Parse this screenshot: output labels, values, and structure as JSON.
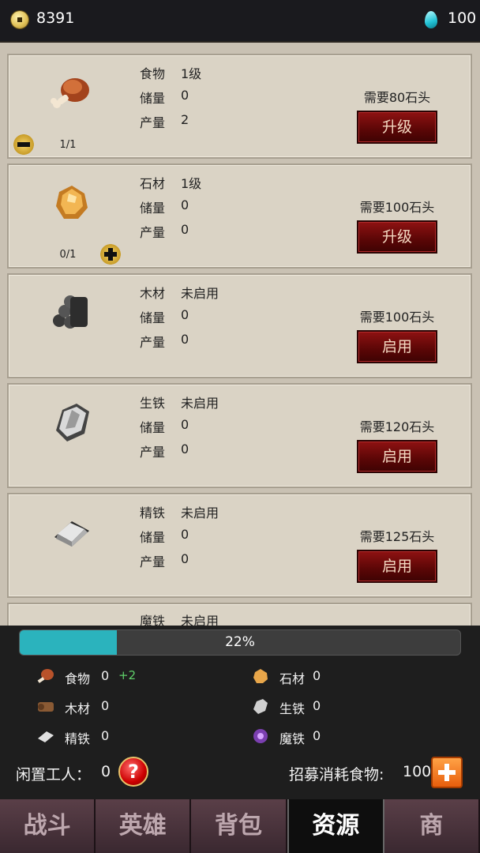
{
  "topbar": {
    "coins": "8391",
    "gems": "100"
  },
  "cards": [
    {
      "name": "食物",
      "level": "1级",
      "stock_label": "储量",
      "stock": "0",
      "prod_label": "产量",
      "prod": "2",
      "need": "需要80石头",
      "button": "升级",
      "workers": "1/1",
      "icon": "meat-icon"
    },
    {
      "name": "石材",
      "level": "1级",
      "stock_label": "储量",
      "stock": "0",
      "prod_label": "产量",
      "prod": "0",
      "need": "需要100石头",
      "button": "升级",
      "workers": "0/1",
      "icon": "stone-icon"
    },
    {
      "name": "木材",
      "level": "未启用",
      "stock_label": "储量",
      "stock": "0",
      "prod_label": "产量",
      "prod": "0",
      "need": "需要100石头",
      "button": "启用",
      "icon": "wood-icon"
    },
    {
      "name": "生铁",
      "level": "未启用",
      "stock_label": "储量",
      "stock": "0",
      "prod_label": "产量",
      "prod": "0",
      "need": "需要120石头",
      "button": "启用",
      "icon": "iron-ore-icon"
    },
    {
      "name": "精铁",
      "level": "未启用",
      "stock_label": "储量",
      "stock": "0",
      "prod_label": "产量",
      "prod": "0",
      "need": "需要125石头",
      "button": "启用",
      "icon": "iron-ingot-icon"
    },
    {
      "name": "魔铁",
      "level": "未启用",
      "icon": "magic-iron-icon"
    }
  ],
  "progress": {
    "text": "22%",
    "value": 0.22
  },
  "summary": {
    "food": {
      "label": "食物",
      "value": "0",
      "delta": "+2"
    },
    "stone": {
      "label": "石材",
      "value": "0"
    },
    "wood": {
      "label": "木材",
      "value": "0"
    },
    "iron": {
      "label": "生铁",
      "value": "0"
    },
    "fine_iron": {
      "label": "精铁",
      "value": "0"
    },
    "magic_iron": {
      "label": "魔铁",
      "value": "0"
    },
    "idle_label": "闲置工人：",
    "idle_value": "0",
    "recruit_label": "招募消耗食物:",
    "recruit_value": "100"
  },
  "tabs": [
    "战斗",
    "英雄",
    "背包",
    "资源",
    "商"
  ]
}
